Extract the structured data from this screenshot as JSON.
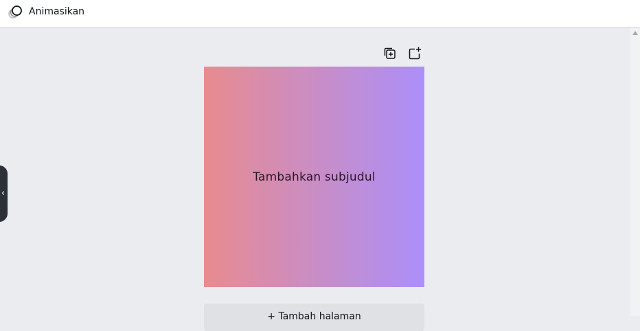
{
  "toolbar": {
    "animate_label": "Animasikan",
    "animate_icon": "animate-circles-icon"
  },
  "page": {
    "actions": {
      "duplicate_icon": "duplicate-page-icon",
      "add_icon": "add-page-icon"
    },
    "canvas": {
      "text": "Tambahkan subjudul",
      "gradient_start": "#e88b8f",
      "gradient_end": "#ab8ffa"
    },
    "add_page_label": "+ Tambah halaman"
  },
  "side_panel": {
    "toggle_icon": "chevron-left-icon",
    "toggle_glyph": "‹"
  },
  "colors": {
    "workspace_bg": "#ebecf0",
    "toolbar_bg": "#ffffff",
    "panel_toggle_bg": "#2c3138"
  }
}
